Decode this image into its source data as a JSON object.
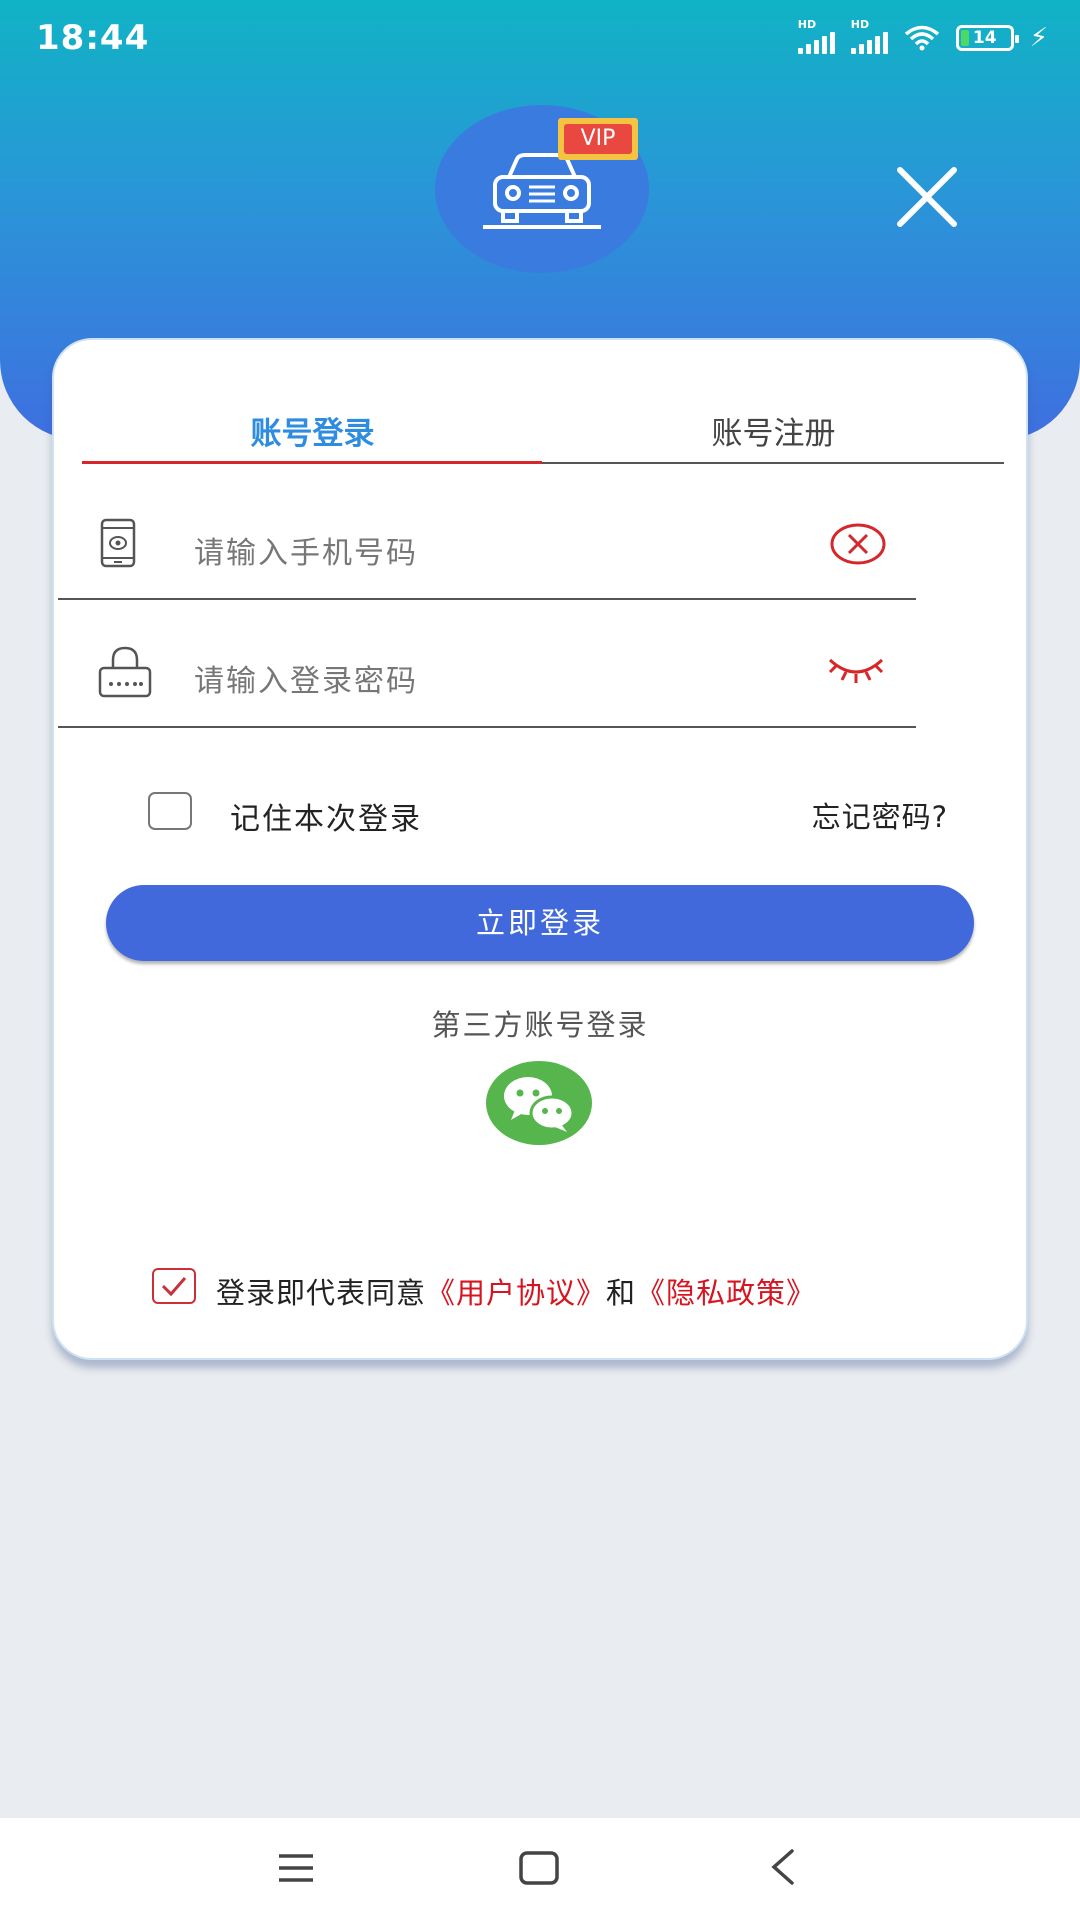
{
  "status_bar": {
    "time": "18:44",
    "signal_label": "HD",
    "battery_level": "14"
  },
  "header": {
    "vip_badge": "VIP"
  },
  "tabs": [
    {
      "label": "账号登录",
      "active": true
    },
    {
      "label": "账号注册",
      "active": false
    }
  ],
  "form": {
    "phone_placeholder": "请输入手机号码",
    "password_placeholder": "请输入登录密码",
    "remember_label": "记住本次登录",
    "remember_checked": false,
    "forgot_password": "忘记密码?",
    "login_button": "立即登录"
  },
  "third_party": {
    "label": "第三方账号登录"
  },
  "agreement": {
    "prefix": "登录即代表同意",
    "user_agreement": "《用户协议》",
    "conjunction": "和",
    "privacy_policy": "《隐私政策》",
    "checked": true
  },
  "colors": {
    "primary": "#4169dc",
    "accent_red": "#d7262a",
    "tab_active": "#2e8de0",
    "wechat": "#56b54c"
  }
}
